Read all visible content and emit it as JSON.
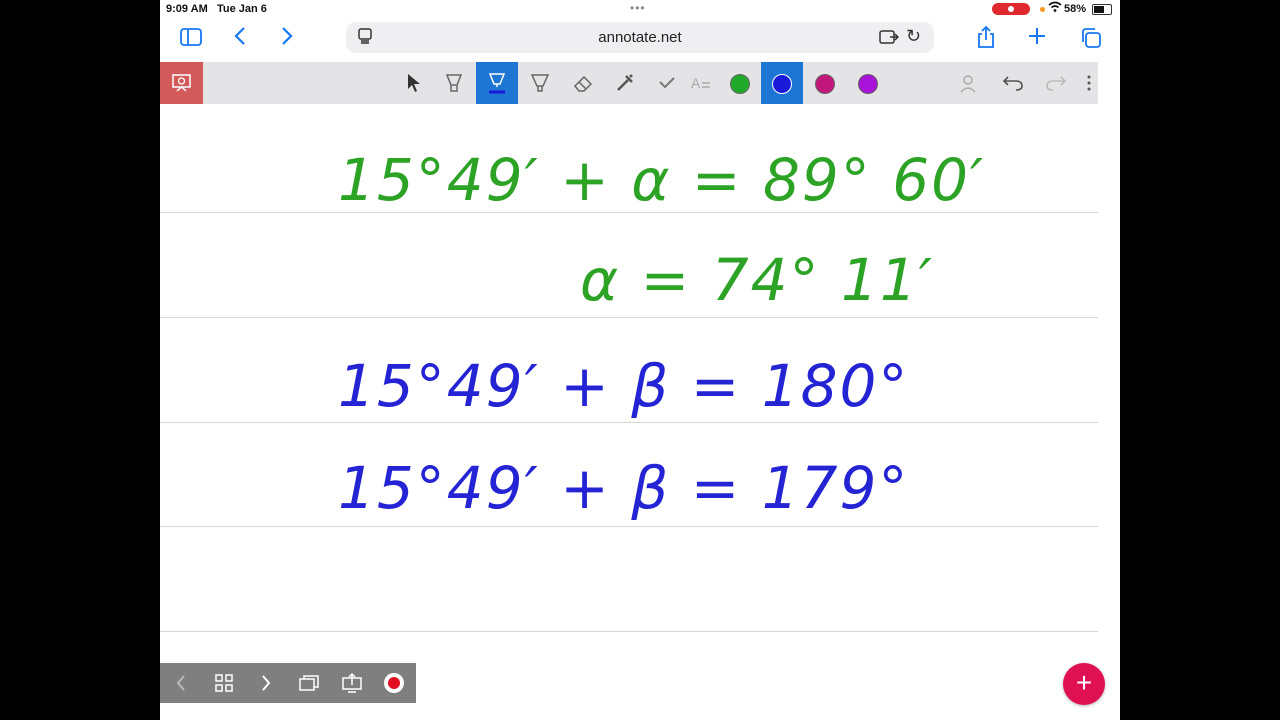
{
  "status_bar": {
    "time": "9:09 AM",
    "date": "Tue Jan 6",
    "battery": "58%"
  },
  "browser": {
    "url": "annotate.net",
    "icons": [
      "sidebar-icon",
      "back-icon",
      "forward-icon",
      "tab-icon",
      "reader-icon",
      "reload-icon",
      "share-icon",
      "new-tab-icon",
      "tabs-icon"
    ]
  },
  "toolbar": {
    "tools": [
      "present-icon",
      "pointer-icon",
      "highlighter-icon",
      "pen-icon",
      "marker-icon",
      "eraser-icon",
      "laser-icon",
      "check-icon",
      "text-icon",
      "profile-icon",
      "undo-icon",
      "redo-icon",
      "more-icon"
    ],
    "colors": [
      "#22a828",
      "#1a1adb",
      "#c2177a",
      "#a614d8"
    ],
    "selected_color": "#1a1adb"
  },
  "notes": {
    "lines": [
      "15°49′ + α = 89° 60′",
      "α = 74° 11′",
      "15°49′ + β = 180°",
      "15°49′ + β = 179°"
    ],
    "colors": [
      "#2da326",
      "#2da326",
      "#2424d4",
      "#2424d4"
    ]
  },
  "bottom_nav": {
    "icons": [
      "prev-page-icon",
      "grid-icon",
      "next-page-icon",
      "duplicate-icon",
      "export-icon",
      "record-icon"
    ]
  },
  "fab": {
    "label": "+"
  }
}
